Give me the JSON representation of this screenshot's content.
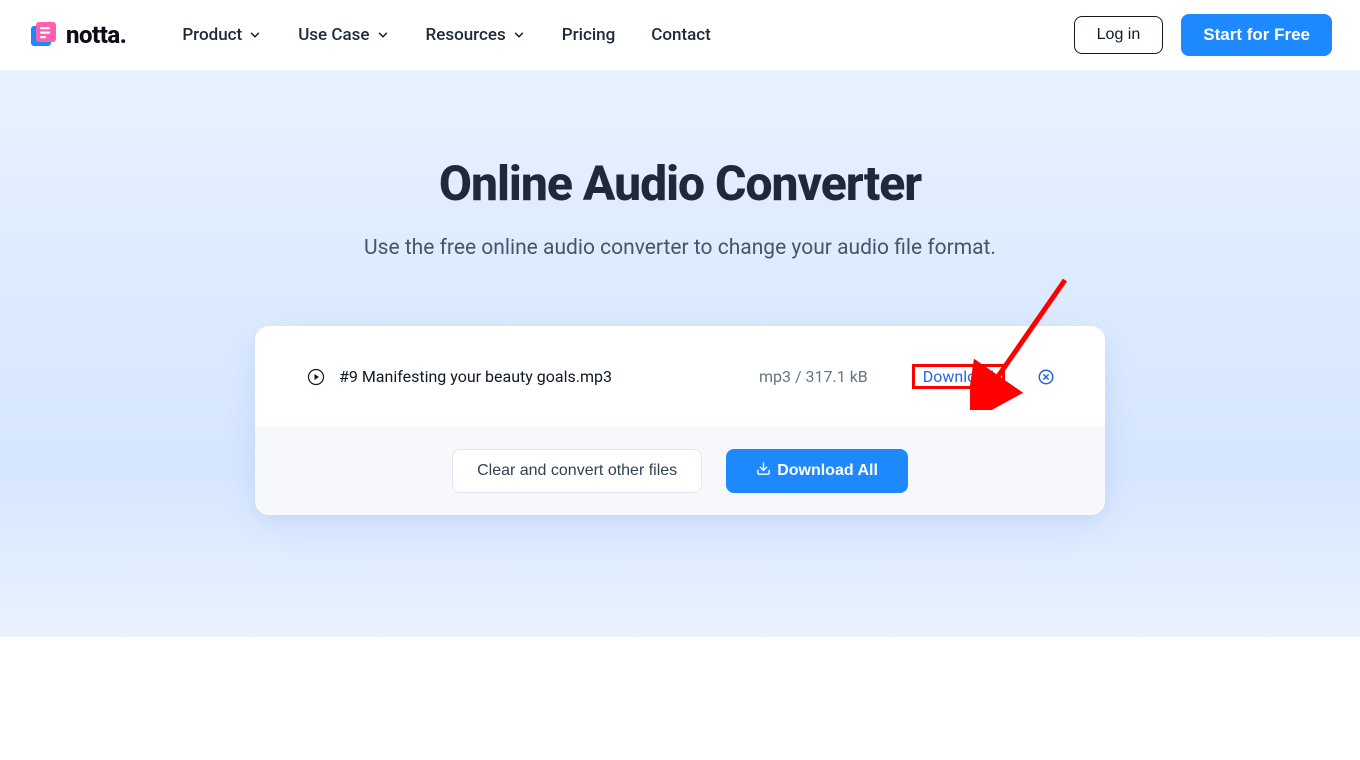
{
  "header": {
    "brand": "notta.",
    "nav": {
      "product": "Product",
      "useCase": "Use Case",
      "resources": "Resources",
      "pricing": "Pricing",
      "contact": "Contact"
    },
    "login": "Log in",
    "startFree": "Start for Free"
  },
  "hero": {
    "title": "Online Audio Converter",
    "subtitle": "Use the free online audio converter to change your audio file format."
  },
  "file": {
    "name": "#9 Manifesting your beauty goals.mp3",
    "meta": "mp3 / 317.1 kB",
    "download": "Download"
  },
  "footer": {
    "clear": "Clear and convert other files",
    "downloadAll": "Download All"
  },
  "colors": {
    "primary": "#1e88ff",
    "highlight": "#ff0000"
  }
}
